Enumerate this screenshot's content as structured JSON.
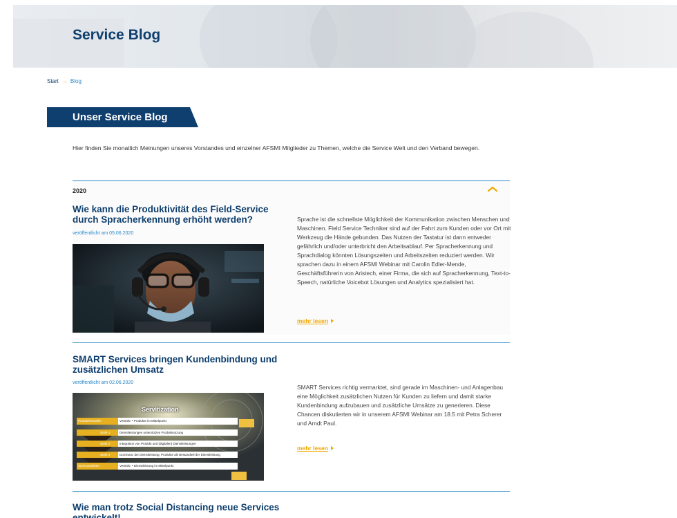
{
  "hero": {
    "title": "Service Blog"
  },
  "breadcrumb": {
    "start": "Start",
    "arrow": "→",
    "current": "Blog"
  },
  "section": {
    "title": "Unser Service Blog"
  },
  "intro": "Hier finden Sie monatlich Meinungen unseres Vorstandes und einzelner AFSMI Mitglieder zu Themen, welche die Service Welt und den Verband bewegen.",
  "year": "2020",
  "posts": [
    {
      "title": "Wie kann die Produktivität des Field-Service durch Spracherkennung erhöht werden?",
      "date": "veröffentlicht am 05.06.2020",
      "text": "Sprache ist die schnellste Möglichkeit der Kommunikation zwischen Menschen und Maschinen. Field Service Techniker sind auf der Fahrt zum Kunden oder vor Ort mit Werkzeug die Hände gebunden. Das Nutzen der Tastatur ist dann entweder gefährlich und/oder unterbricht den Arbeitsablauf. Per Spracherkennung und Sprachdialog könnten Lösungszeiten und Arbeitszeiten reduziert werden. Wir sprachen dazu in einem AFSMI Webinar mit Carolin Edler-Mende, Geschäftsführerin von Aristech, einer Firma, die sich auf Spracherkennung, Text-to-Speech, natürliche Voicebot Lösungen und Analytics spezialisiert hat.",
      "more": "mehr lesen"
    },
    {
      "title": "SMART Services bringen Kundenbindung und zusätzlichen Umsatz",
      "date": "veröffentlicht am 02.06.2020",
      "text": "SMART Services richtig vermarktet, sind gerade im Maschinen- und Anlagenbau eine Möglichkeit zusätzlichen Nutzen für Kunden zu liefern und damit starke Kundenbindung aufzubauen und zusätzliche Umsätze zu generieren. Diese Chancen diskutierten wir in unserem AFSMI Webinar am 18.5 mit Petra Scherer und Arndt Paul.",
      "more": "mehr lesen",
      "image": {
        "heading": "Servitization",
        "rows": [
          {
            "tag": "Produkthersteller",
            "text": "Vertrieb:   •   Produkte im Mittelpunkt"
          },
          {
            "tag": "Stufe 1",
            "text": "Dienstleistungen unterstützen Produktnutzung"
          },
          {
            "tag": "Stufe 2",
            "text": "Integration von Produkt und (digitalen) Dienstleistungen"
          },
          {
            "tag": "Stufe 3",
            "text": "Dominanz der Dienstleistung: Produkte als Bestandteil der Dienstleistung"
          },
          {
            "tag": "Serviceanbieter",
            "text": "Vertrieb:   •   Dienstleistung im Mittelpunkt"
          }
        ]
      }
    },
    {
      "title": "Wie man trotz Social Distancing neue Services entwickelt!"
    }
  ],
  "colors": {
    "primary": "#0f3f6e",
    "accent": "#f0a800",
    "link": "#2a88c8"
  }
}
